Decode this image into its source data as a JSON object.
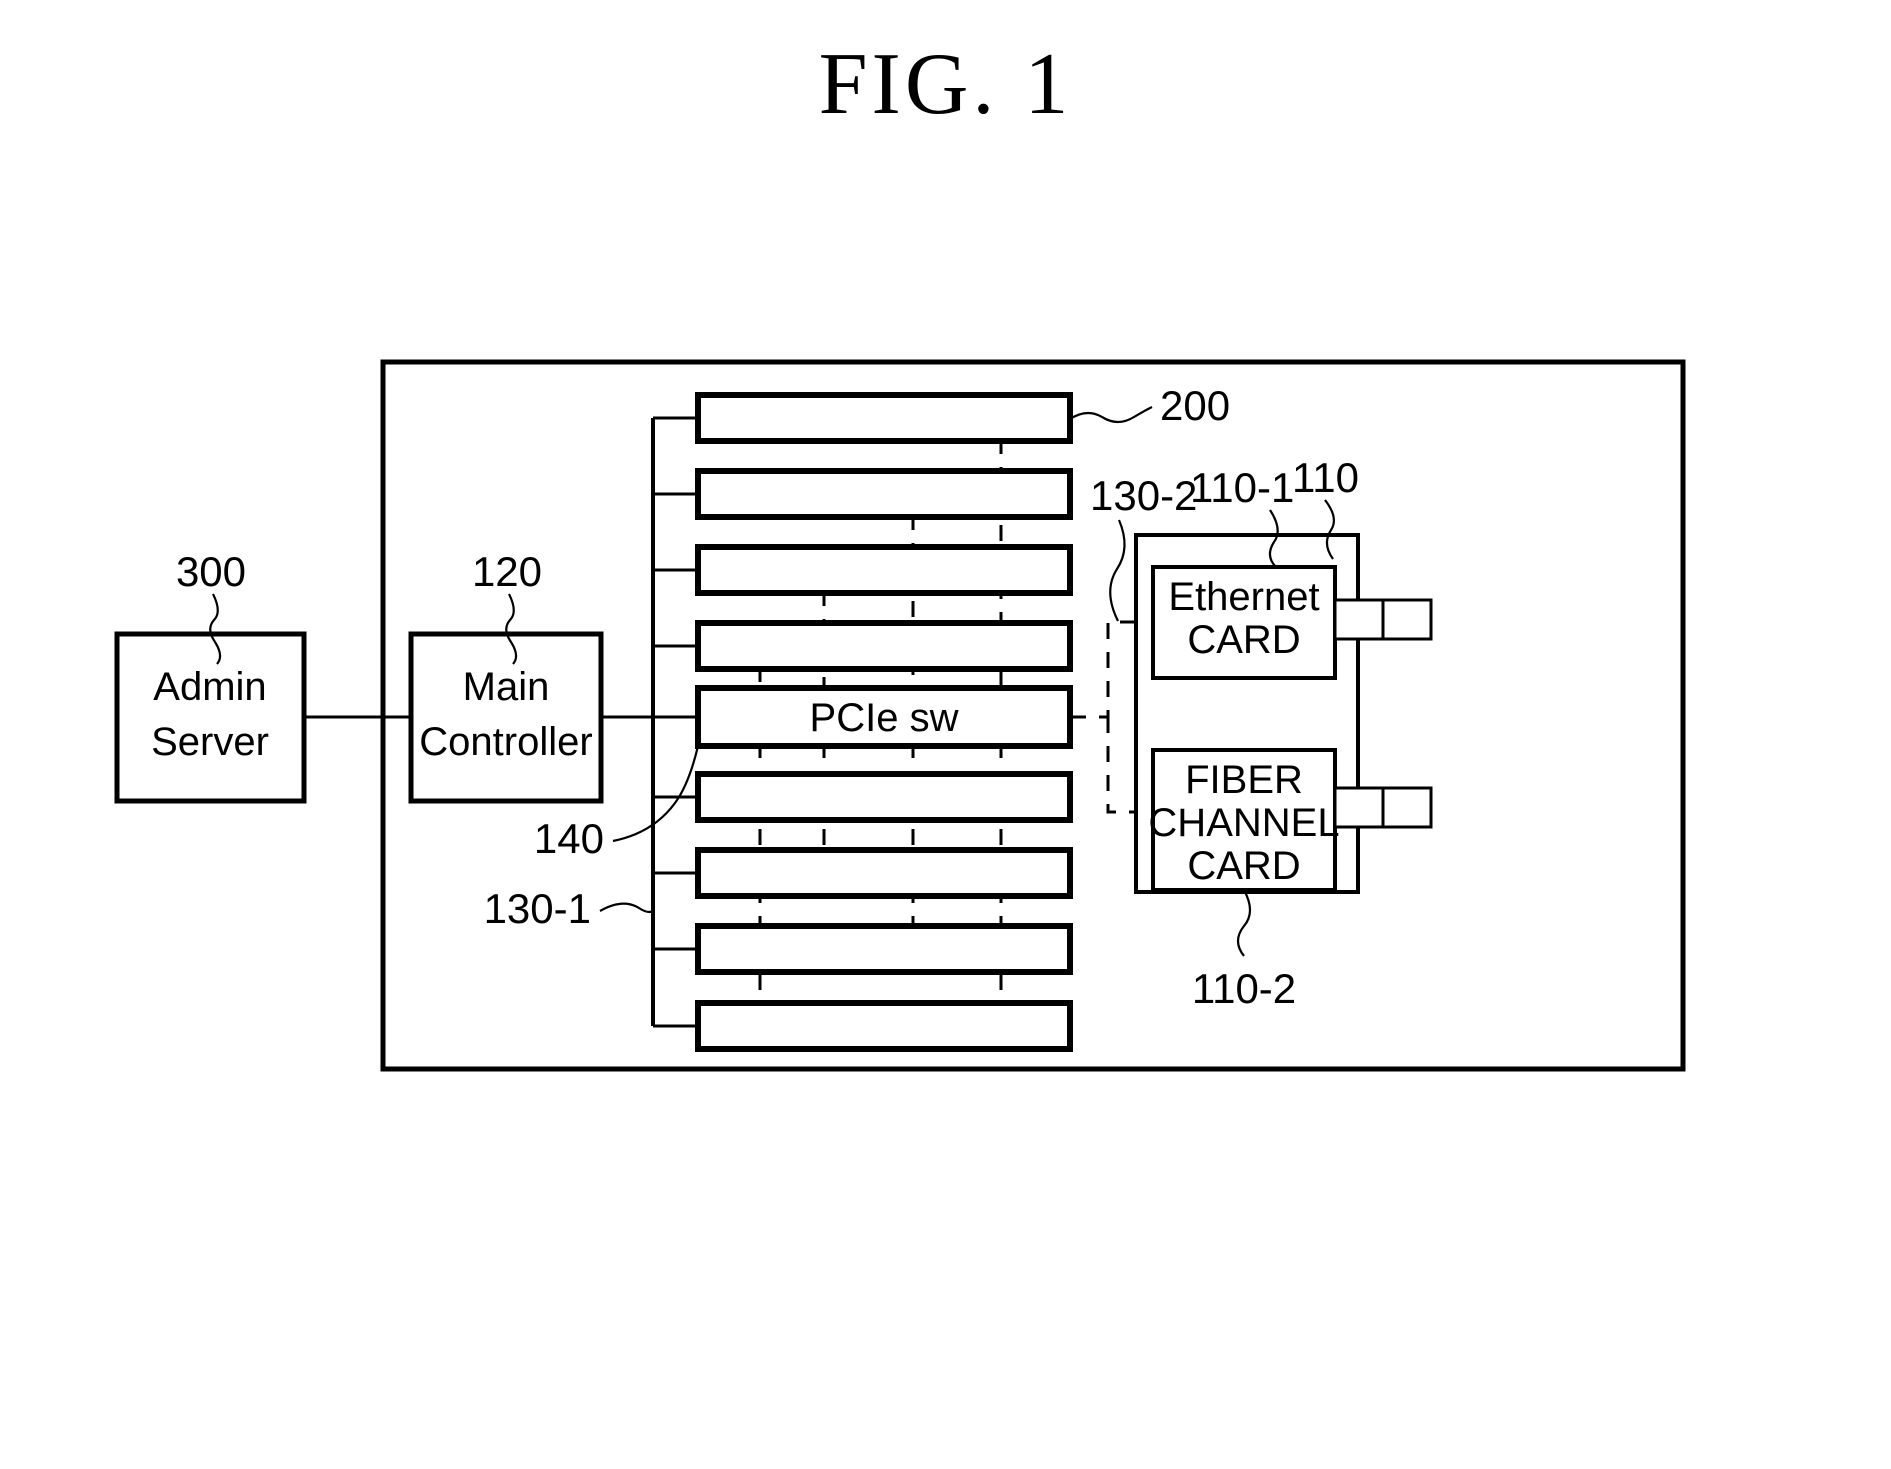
{
  "figure": {
    "title": "FIG.  1"
  },
  "blocks": {
    "admin_server": {
      "line1": "Admin",
      "line2": "Server",
      "ref": "300"
    },
    "main_controller": {
      "line1": "Main",
      "line2": "Controller",
      "ref": "120"
    },
    "pcie_switch": {
      "label": "PCIe sw",
      "ref": "140"
    },
    "ethernet_card": {
      "line1": "Ethernet",
      "line2": "CARD",
      "ref": "110-1"
    },
    "fiber_channel_card": {
      "line1": "FIBER",
      "line2": "CHANNEL",
      "line3": "CARD",
      "ref": "110-2"
    },
    "card_group": {
      "ref": "110"
    },
    "storage_module": {
      "ref": "200"
    },
    "bus_left": {
      "ref": "130-1"
    },
    "bus_right": {
      "ref": "130-2"
    }
  },
  "slots": [
    {
      "index": 1,
      "label": ""
    },
    {
      "index": 2,
      "label": ""
    },
    {
      "index": 3,
      "label": ""
    },
    {
      "index": 4,
      "label": ""
    },
    {
      "index": 5,
      "label": "PCIe sw"
    },
    {
      "index": 6,
      "label": ""
    },
    {
      "index": 7,
      "label": ""
    },
    {
      "index": 8,
      "label": ""
    },
    {
      "index": 9,
      "label": ""
    }
  ],
  "colors": {
    "stroke": "#000000",
    "background": "#ffffff"
  }
}
